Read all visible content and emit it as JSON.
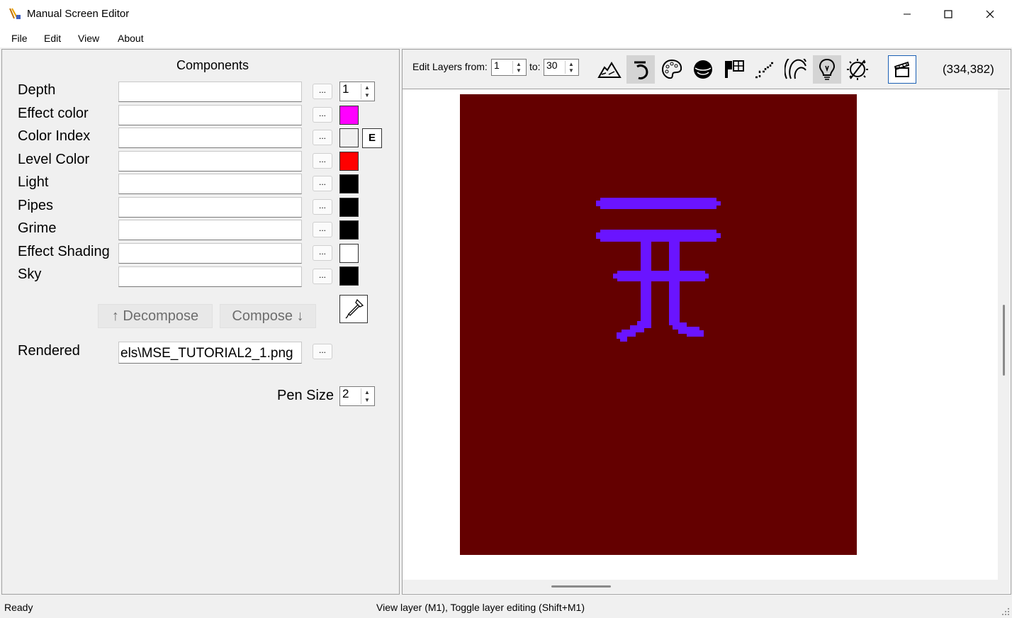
{
  "window": {
    "title": "Manual Screen Editor",
    "minimize": "—",
    "maximize": "☐",
    "close": "✕"
  },
  "menu": [
    "File",
    "Edit",
    "View",
    "About"
  ],
  "components": {
    "title": "Components",
    "rows": [
      {
        "label": "Depth",
        "color": null
      },
      {
        "label": "Effect color",
        "color": "#ff00ff"
      },
      {
        "label": "Color Index",
        "color": "#f0f0f0"
      },
      {
        "label": "Level Color",
        "color": "#ff0000"
      },
      {
        "label": "Light",
        "color": "#000000"
      },
      {
        "label": "Pipes",
        "color": "#000000"
      },
      {
        "label": "Grime",
        "color": "#000000"
      },
      {
        "label": "Effect Shading",
        "color": "#ffffff"
      },
      {
        "label": "Sky",
        "color": "#000000"
      }
    ],
    "dots_label": "...",
    "depth_value": "1",
    "e_button": "E",
    "decompose_label": "↑ Decompose",
    "compose_label": "Compose ↓",
    "dropper_icon": "eyedropper-icon",
    "rendered_label": "Rendered",
    "rendered_value": "els\\MSE_TUTORIAL2_1.png",
    "pen_size_label": "Pen Size",
    "pen_size_value": "2"
  },
  "toolbar": {
    "edit_layers_label": "Edit Layers from:",
    "from_value": "1",
    "to_label": "to:",
    "to_value": "30",
    "tools": [
      "terrain-icon",
      "pipe-hook-icon",
      "palette-icon",
      "sphere-icon",
      "shortcut-icon",
      "dotted-path-icon",
      "rainbow-icon",
      "lightbulb-icon",
      "no-sun-icon"
    ],
    "active_tools": [
      "pipe-hook-icon",
      "lightbulb-icon"
    ],
    "render_icon": "clapperboard-icon",
    "coordinates": "(334,382)"
  },
  "canvas": {
    "background": "#640000",
    "glyph_color": "#6a14ff"
  },
  "status": {
    "left": "Ready",
    "center": "View layer (M1), Toggle layer editing (Shift+M1)"
  }
}
